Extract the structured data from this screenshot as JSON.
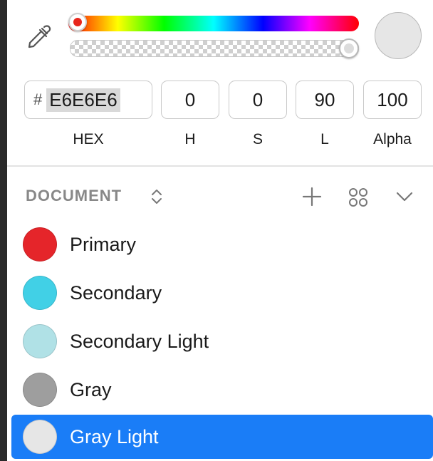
{
  "picker": {
    "preview_color": "#e6e6e6",
    "hue_knob_color": "#e8261c",
    "hue_position": 0,
    "alpha_position": 1.0
  },
  "inputs": {
    "hash_symbol": "#",
    "hex": "E6E6E6",
    "h": "0",
    "s": "0",
    "l": "90",
    "alpha": "100"
  },
  "labels": {
    "hex": "HEX",
    "h": "H",
    "s": "S",
    "l": "L",
    "alpha": "Alpha"
  },
  "document": {
    "title": "DOCUMENT",
    "icons": [
      "sort-toggle-icon",
      "plus-icon",
      "grid-view-icon",
      "chevron-down-icon"
    ]
  },
  "swatches": [
    {
      "name": "Primary",
      "color": "#e5252a",
      "selected": false
    },
    {
      "name": "Secondary",
      "color": "#41d0e6",
      "selected": false
    },
    {
      "name": "Secondary Light",
      "color": "#b0e1e6",
      "selected": false
    },
    {
      "name": "Gray",
      "color": "#9e9e9e",
      "selected": false
    },
    {
      "name": "Gray Light",
      "color": "#e6e6e6",
      "selected": true
    }
  ],
  "colors": {
    "accent": "#1a7df7",
    "panel_bg": "#ffffff",
    "section_title": "#888888"
  }
}
